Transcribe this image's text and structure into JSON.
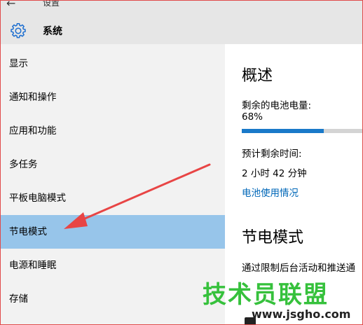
{
  "window": {
    "title": "设置"
  },
  "header": {
    "section_title": "系统"
  },
  "sidebar": {
    "items": [
      {
        "label": "显示",
        "selected": false
      },
      {
        "label": "通知和操作",
        "selected": false
      },
      {
        "label": "应用和功能",
        "selected": false
      },
      {
        "label": "多任务",
        "selected": false
      },
      {
        "label": "平板电脑模式",
        "selected": false
      },
      {
        "label": "节电模式",
        "selected": true
      },
      {
        "label": "电源和睡眠",
        "selected": false
      },
      {
        "label": "存储",
        "selected": false
      }
    ]
  },
  "main": {
    "overview_heading": "概述",
    "battery_label": "剩余的电池电量:",
    "battery_percent_text": "68%",
    "battery_level": 0.68,
    "remaining_time_label": "预计剩余时间:",
    "remaining_time_value": "2 小时 42 分钟",
    "battery_usage_link": "电池使用情况",
    "saver_heading": "节电模式",
    "saver_description": "通过限制后台活动和推送通"
  },
  "watermark": {
    "text": "技术员联盟",
    "url": "www.jsgho.com"
  },
  "colors": {
    "sidebar_bg": "#f2f2f2",
    "selected_bg": "#97c5ea",
    "accent": "#1979c9",
    "link": "#0067b8",
    "annotation_arrow": "#e84545",
    "watermark": "#36c13c"
  }
}
